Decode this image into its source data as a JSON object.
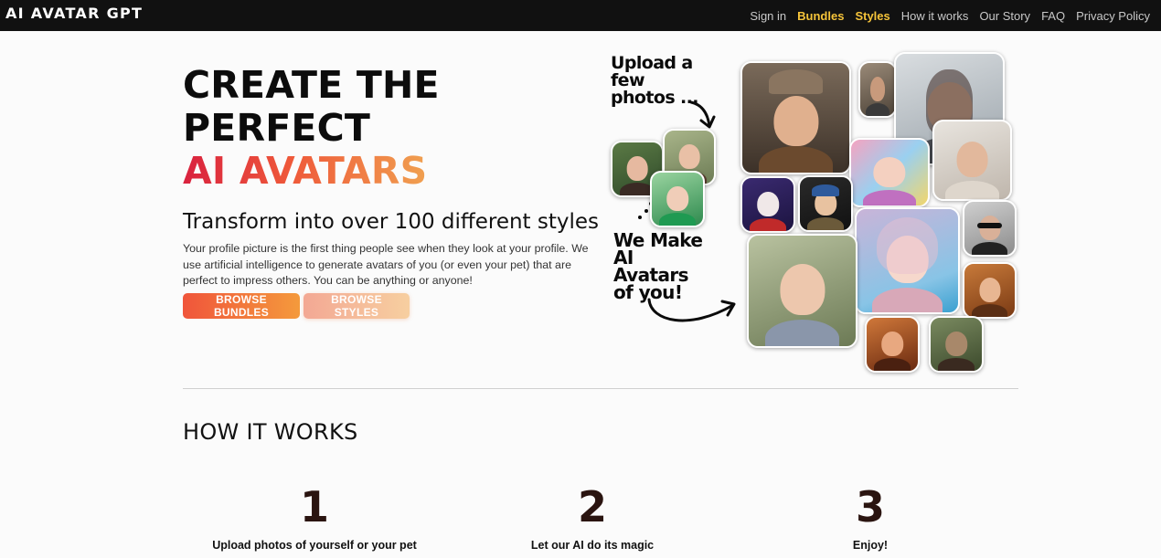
{
  "brand": "AI AVATAR GPT",
  "nav": {
    "links": [
      {
        "label": "Sign in"
      },
      {
        "label": "Bundles"
      },
      {
        "label": "Styles"
      },
      {
        "label": "How it works"
      },
      {
        "label": "Our Story"
      },
      {
        "label": "FAQ"
      },
      {
        "label": "Privacy Policy"
      }
    ]
  },
  "hero": {
    "title_line1": "CREATE THE",
    "title_line2": "PERFECT",
    "title_line3": "AI AVATARS",
    "subtitle": "Transform into over 100 different styles",
    "description": "Your profile picture is the first thing people see when they look at your profile. We use artificial intelligence to generate avatars of you (or even your pet) that are perfect to impress others. You can be anything or anyone!",
    "btn_bundles": "BROWSE BUNDLES",
    "btn_styles": "BROWSE STYLES",
    "collage_text1": "Upload a few photos ...",
    "collage_text2": "We Make AI Avatars of you!"
  },
  "how": {
    "title": "HOW IT WORKS",
    "steps": [
      {
        "num": "1",
        "text": "Upload photos of yourself or your pet"
      },
      {
        "num": "2",
        "text": "Let our AI do its magic"
      },
      {
        "num": "3",
        "text": "Enjoy!"
      }
    ]
  },
  "colors": {
    "nav_bg": "#111111",
    "nav_active": "#f6c43a",
    "accent_start": "#f0553b",
    "accent_end": "#f49a3c"
  }
}
